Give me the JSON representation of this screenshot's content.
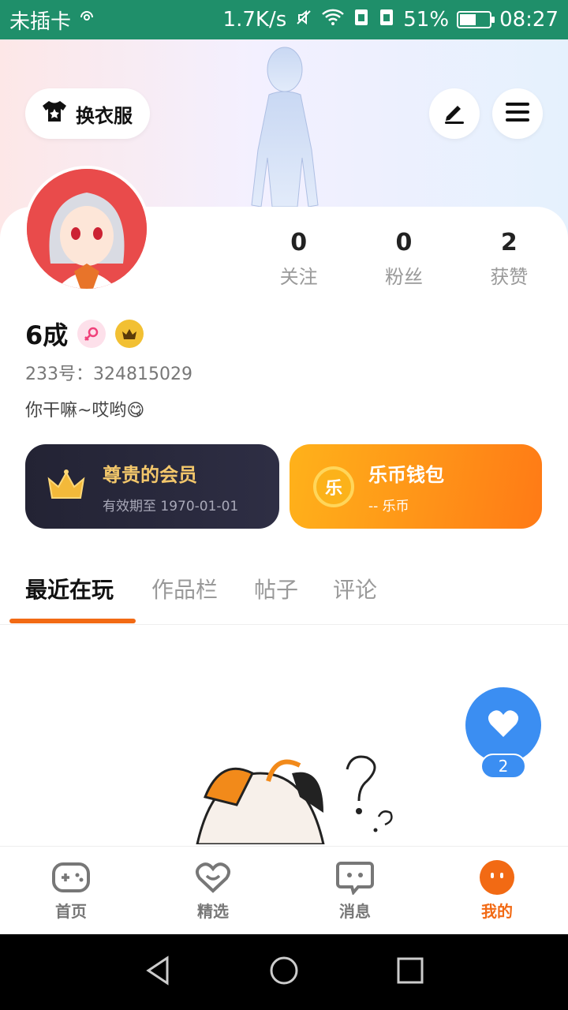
{
  "status_bar": {
    "carrier": "未插卡",
    "speed": "1.7K/s",
    "battery": "51%",
    "time": "08:27"
  },
  "header": {
    "dress_button": "换衣服"
  },
  "profile": {
    "stats": [
      {
        "value": "0",
        "label": "关注"
      },
      {
        "value": "0",
        "label": "粉丝"
      },
      {
        "value": "2",
        "label": "获赞"
      }
    ],
    "username": "6成",
    "uid": "233号：324815029",
    "bio": "你干嘛~哎哟😋"
  },
  "cards": {
    "vip_title": "尊贵的会员",
    "vip_sub": "有效期至 1970-01-01",
    "wallet_title": "乐币钱包",
    "wallet_sub": "-- 乐币",
    "wallet_coin_char": "乐"
  },
  "tabs": [
    "最近在玩",
    "作品栏",
    "帖子",
    "评论"
  ],
  "like_count": "2",
  "bottom_nav": [
    "首页",
    "精选",
    "消息",
    "我的"
  ],
  "colors": {
    "accent": "#f26a14",
    "status_bar": "#1f8f6a",
    "fab": "#3b8ef2"
  }
}
